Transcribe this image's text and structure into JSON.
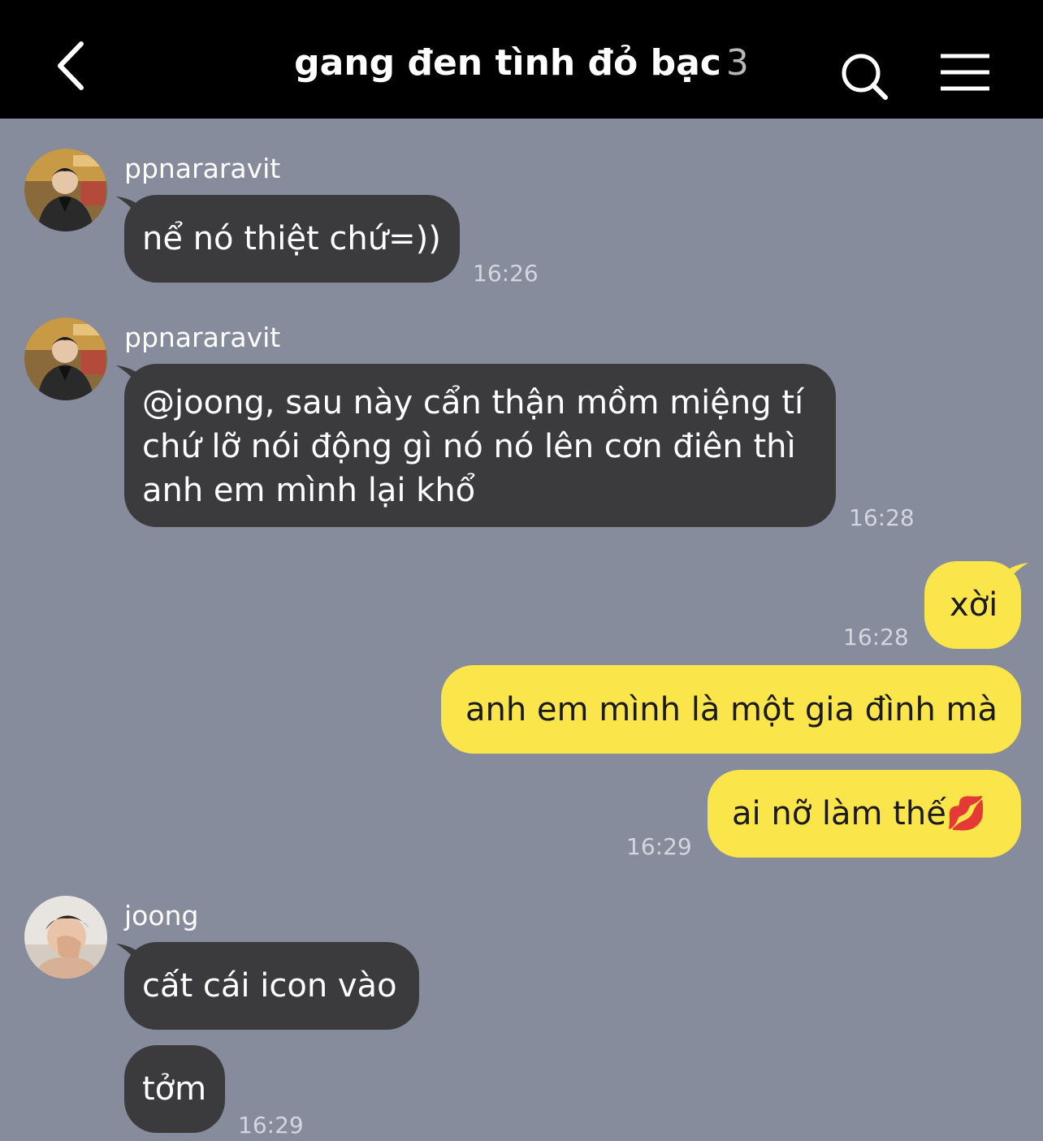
{
  "header": {
    "title": "gang đen tình đỏ bạc",
    "member_count": "3"
  },
  "messages": [
    {
      "sender": "ppnararavit",
      "text": "nể nó thiệt chứ=))",
      "time": "16:26"
    },
    {
      "sender": "ppnararavit",
      "lines": [
        "@joong, sau này cẩn thận mồm miệng tí",
        "chứ lỡ nói động gì nó nó lên cơn điên thì",
        "anh em mình lại khổ"
      ],
      "time": "16:28"
    },
    {
      "sender": "me",
      "text": "xời",
      "time": "16:28"
    },
    {
      "sender": "me",
      "text": "anh em mình là một gia đình mà"
    },
    {
      "sender": "me",
      "text": "ai nỡ làm thế",
      "emoji": "💋",
      "time": "16:29"
    },
    {
      "sender": "joong",
      "text": "cất cái icon vào"
    },
    {
      "sender": "joong",
      "text": "tởm",
      "time": "16:29"
    }
  ],
  "colors": {
    "background": "#868c9b",
    "header": "#000000",
    "incoming_bubble": "#3b3b3e",
    "outgoing_bubble": "#fae54b"
  },
  "icons": [
    "back-chevron-icon",
    "search-icon",
    "menu-icon",
    "lips-emoji-icon"
  ]
}
